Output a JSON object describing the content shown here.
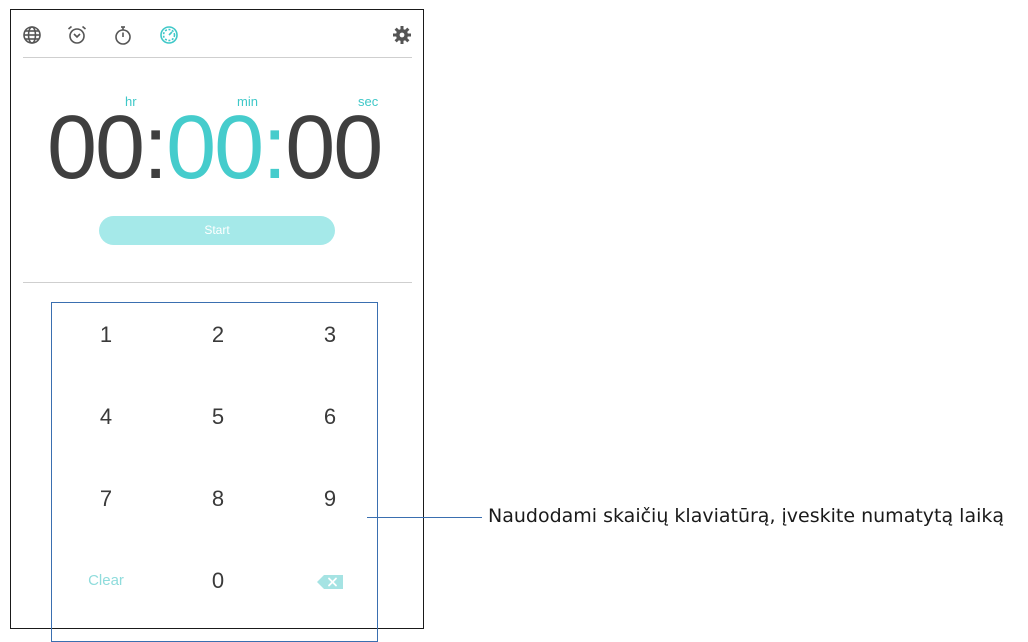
{
  "tabs": [
    {
      "name": "world-clock",
      "icon": "globe-icon"
    },
    {
      "name": "alarm",
      "icon": "alarm-clock-icon"
    },
    {
      "name": "stopwatch",
      "icon": "stopwatch-icon"
    },
    {
      "name": "timer",
      "icon": "timer-icon",
      "active": true
    }
  ],
  "settings_icon": "gear-icon",
  "timer": {
    "labels": {
      "hr": "hr",
      "min": "min",
      "sec": "sec"
    },
    "hours": "00",
    "minutes": "00",
    "seconds": "00",
    "separator": ":"
  },
  "start_button": "Start",
  "keypad": {
    "row1": [
      "1",
      "2",
      "3"
    ],
    "row2": [
      "4",
      "5",
      "6"
    ],
    "row3": [
      "7",
      "8",
      "9"
    ],
    "clear": "Clear",
    "zero": "0",
    "backspace_icon": "backspace-icon"
  },
  "callout": "Naudodami skaičių klaviatūrą, įveskite numatytą laiką",
  "colors": {
    "accent": "#45cccc",
    "button": "#a5e9e9",
    "icon": "#555555",
    "callout_border": "#3a6fb0"
  }
}
